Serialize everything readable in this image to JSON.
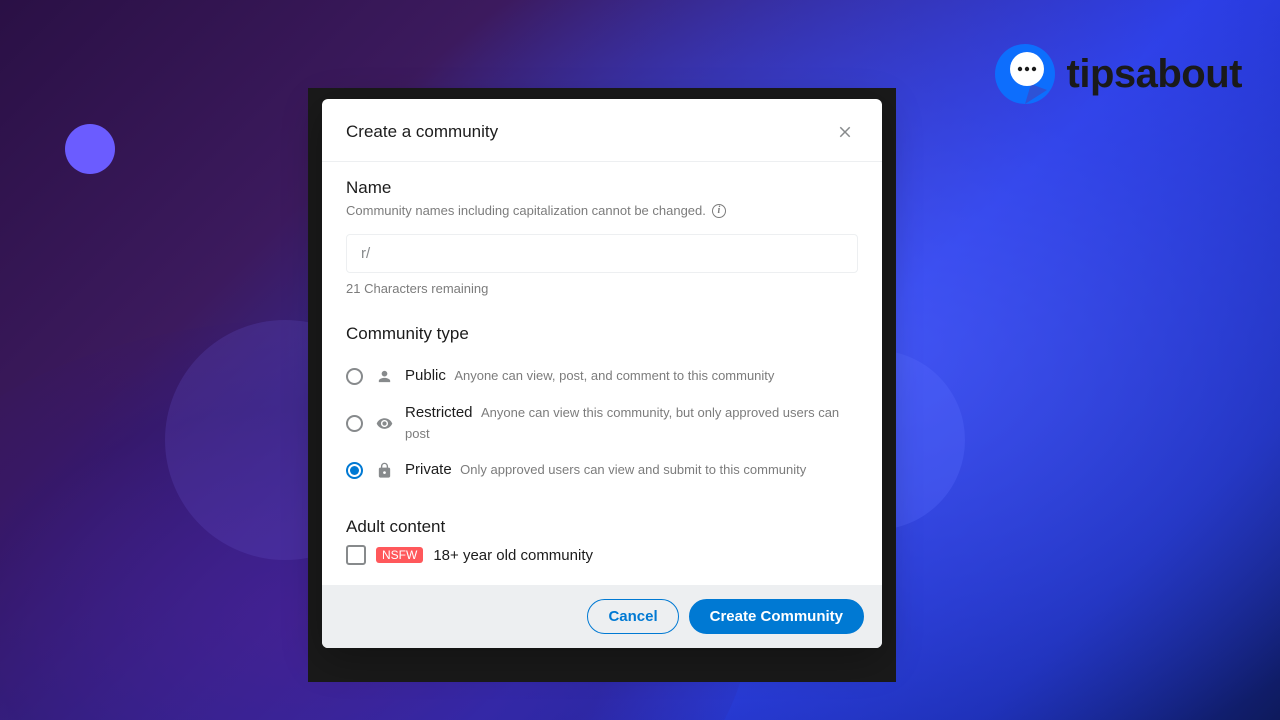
{
  "brand": {
    "name": "tipsabout"
  },
  "modal": {
    "title": "Create a community",
    "name_section": {
      "label": "Name",
      "hint": "Community names including capitalization cannot be changed.",
      "placeholder": "r/",
      "value": "",
      "counter": "21 Characters remaining"
    },
    "type_section": {
      "label": "Community type",
      "options": [
        {
          "name": "Public",
          "desc": "Anyone can view, post, and comment to this community",
          "icon": "person",
          "selected": false
        },
        {
          "name": "Restricted",
          "desc": "Anyone can view this community, but only approved users can post",
          "icon": "eye",
          "selected": false
        },
        {
          "name": "Private",
          "desc": "Only approved users can view and submit to this community",
          "icon": "lock",
          "selected": true
        }
      ]
    },
    "adult_section": {
      "label": "Adult content",
      "badge": "NSFW",
      "checkbox_label": "18+ year old community",
      "checked": false
    },
    "footer": {
      "cancel": "Cancel",
      "submit": "Create Community"
    }
  }
}
